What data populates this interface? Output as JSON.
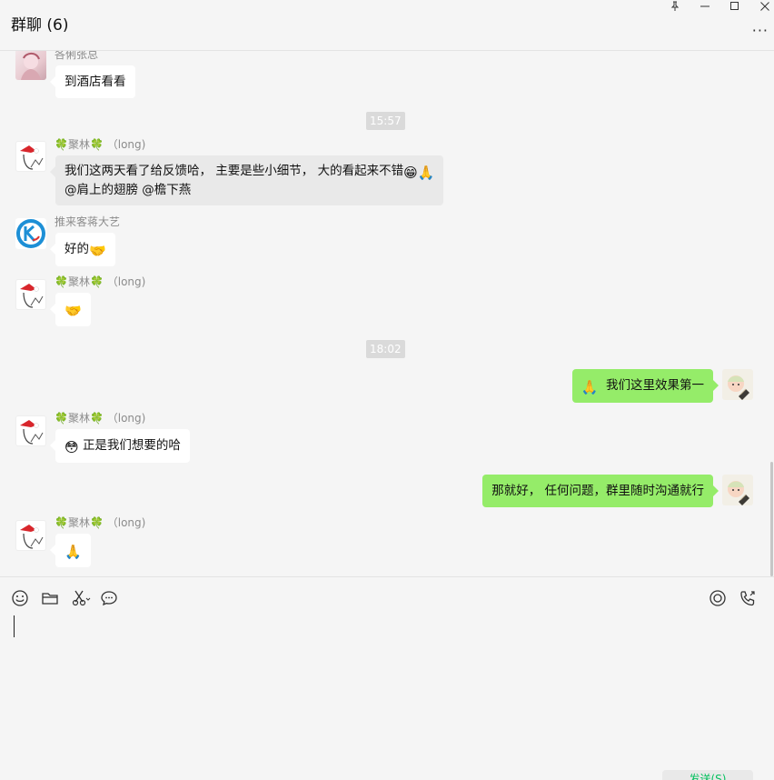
{
  "window": {
    "title": "群聊 (6)",
    "more_label": "···"
  },
  "messages": {
    "m1": {
      "sender": "各俐张总",
      "text": "到酒店看看"
    },
    "ts1": "15:57",
    "m2": {
      "sender_name": "聚林",
      "sender_suffix": "（long)",
      "line1": "我们这两天看了给反馈哈， 主要是些小细节， 大的看起来不错",
      "emoji1": "😁",
      "emoji2": "🙏",
      "line2": "@肩上的翅膀 @檐下燕"
    },
    "m3": {
      "sender": "推来客蒋大艺",
      "text": "好的",
      "emoji": "🤝"
    },
    "m4": {
      "sender_name": "聚林",
      "sender_suffix": "（long)",
      "emoji": "🤝"
    },
    "ts2": "18:02",
    "m5": {
      "emoji": "🙏",
      "text": "我们这里效果第一"
    },
    "m6": {
      "sender_name": "聚林",
      "sender_suffix": "（long)",
      "emoji": "😳",
      "text": "正是我们想要的哈"
    },
    "m7": {
      "text": "那就好， 任何问题，群里随时沟通就行"
    },
    "m8": {
      "sender_name": "聚林",
      "sender_suffix": "（long)",
      "emoji": "🙏"
    }
  },
  "clover": "🍀",
  "input": {
    "send_label": "发送(S)"
  },
  "colors": {
    "background": "#f5f5f5",
    "self_bubble": "#95ec69",
    "other_bubble": "#ffffff",
    "timestamp_bg": "#dadada",
    "send_text": "#07c160"
  }
}
